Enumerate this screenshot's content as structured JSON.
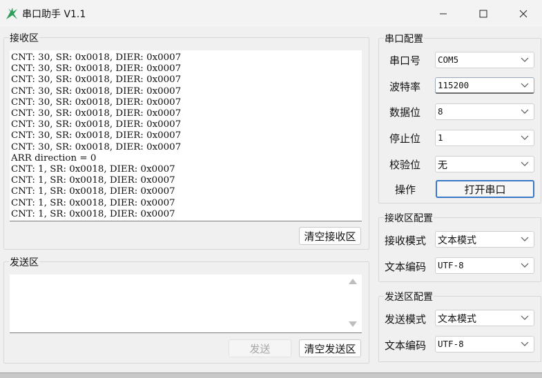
{
  "window": {
    "title": "串口助手 V1.1",
    "controls": {
      "minimize": "minimize",
      "maximize": "maximize",
      "close": "close"
    }
  },
  "receive": {
    "group_label": "接收区",
    "lines": [
      "CNT: 30, SR: 0x0018, DIER: 0x0007",
      "CNT: 30, SR: 0x0018, DIER: 0x0007",
      "CNT: 30, SR: 0x0018, DIER: 0x0007",
      "CNT: 30, SR: 0x0018, DIER: 0x0007",
      "CNT: 30, SR: 0x0018, DIER: 0x0007",
      "CNT: 30, SR: 0x0018, DIER: 0x0007",
      "CNT: 30, SR: 0x0018, DIER: 0x0007",
      "CNT: 30, SR: 0x0018, DIER: 0x0007",
      "CNT: 30, SR: 0x0018, DIER: 0x0007",
      "ARR direction = 0",
      "CNT: 1, SR: 0x0018, DIER: 0x0007",
      "CNT: 1, SR: 0x0018, DIER: 0x0007",
      "CNT: 1, SR: 0x0018, DIER: 0x0007",
      "CNT: 1, SR: 0x0018, DIER: 0x0007",
      "CNT: 1, SR: 0x0018, DIER: 0x0007"
    ],
    "clear_button": "清空接收区"
  },
  "send": {
    "group_label": "发送区",
    "text": "",
    "send_button": "发送",
    "clear_button": "清空发送区"
  },
  "serial_config": {
    "group_label": "串口配置",
    "port": {
      "label": "串口号",
      "value": "COM5"
    },
    "baud": {
      "label": "波特率",
      "value": "115200"
    },
    "data_bits": {
      "label": "数据位",
      "value": "8"
    },
    "stop_bits": {
      "label": "停止位",
      "value": "1"
    },
    "parity": {
      "label": "校验位",
      "value": "无"
    },
    "operation": {
      "label": "操作",
      "button": "打开串口"
    }
  },
  "receive_config": {
    "group_label": "接收区配置",
    "mode": {
      "label": "接收模式",
      "value": "文本模式"
    },
    "encoding": {
      "label": "文本编码",
      "value": "UTF-8"
    }
  },
  "send_config": {
    "group_label": "发送区配置",
    "mode": {
      "label": "发送模式",
      "value": "文本模式"
    },
    "encoding": {
      "label": "文本编码",
      "value": "UTF-8"
    }
  },
  "colors": {
    "accent": "#3877c7",
    "icon_green": "#2e9e5b"
  }
}
